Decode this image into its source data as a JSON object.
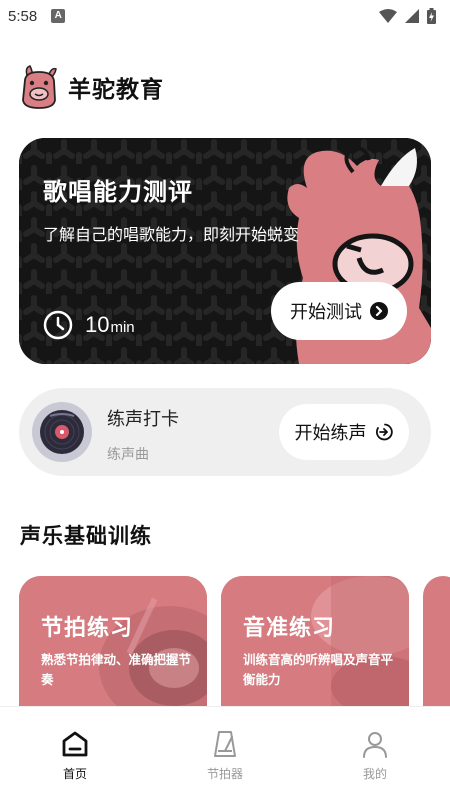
{
  "status_bar": {
    "time": "5:58",
    "notification_letter": "A"
  },
  "header": {
    "title": "羊驼教育",
    "logo_icon": "alpaca-logo-icon"
  },
  "hero": {
    "title": "歌唱能力测评",
    "subtitle": "了解自己的唱歌能力，即刻开始蜕变",
    "duration_value": "10",
    "duration_unit": "min",
    "button_label": "开始测试",
    "colors": {
      "background": "#151515",
      "mascot": "#d97e83"
    }
  },
  "checkin": {
    "title": "练声打卡",
    "subtitle": "练声曲",
    "button_label": "开始练声"
  },
  "section": {
    "title": "声乐基础训练"
  },
  "courses": [
    {
      "title": "节拍练习",
      "desc": "熟悉节拍律动、准确把握节奏"
    },
    {
      "title": "音准练习",
      "desc": "训练音高的听辨唱及声音平衡能力"
    }
  ],
  "bottom_nav": [
    {
      "label": "首页",
      "icon": "home-icon",
      "active": true
    },
    {
      "label": "节拍器",
      "icon": "metronome-icon",
      "active": false
    },
    {
      "label": "我的",
      "icon": "profile-icon",
      "active": false
    }
  ],
  "accent_color": "#d67b80"
}
